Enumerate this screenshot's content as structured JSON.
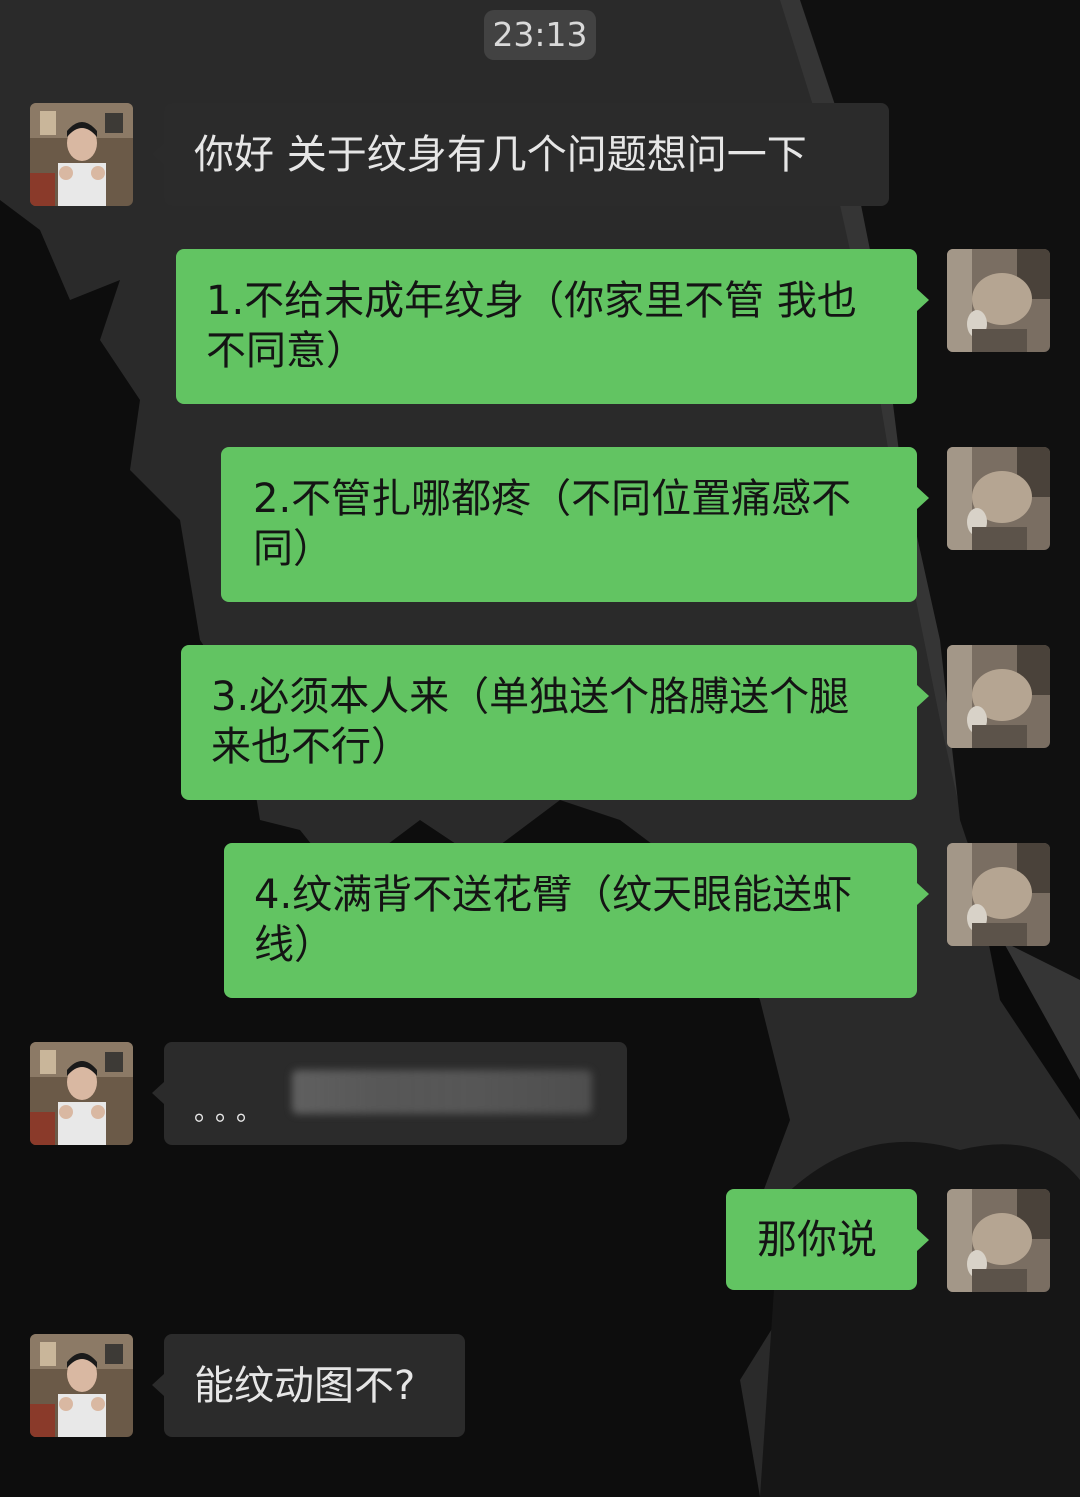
{
  "status": {
    "time": "23:13"
  },
  "contacts": {
    "other_avatar": "person-avatar",
    "self_avatar": "cat-photo-avatar"
  },
  "messages": [
    {
      "side": "in",
      "text": "你好 关于纹身有几个问题想问一下"
    },
    {
      "side": "out",
      "lines": [
        "1.不给未成年纹身（你家里不管 我也",
        "不同意）"
      ]
    },
    {
      "side": "out",
      "lines": [
        "2.不管扎哪都疼（不同位置痛感不",
        "同）"
      ]
    },
    {
      "side": "out",
      "lines": [
        "3.必须本人来（单独送个胳膊送个腿",
        "来也不行）"
      ]
    },
    {
      "side": "out",
      "lines": [
        "4.纹满背不送花臂（纹天眼能送虾",
        "线）"
      ]
    },
    {
      "side": "in",
      "text": "。。。",
      "note": "redacted"
    },
    {
      "side": "out",
      "text": "那你说"
    },
    {
      "side": "in",
      "text": "能纹动图不?"
    }
  ],
  "colors": {
    "incoming_bubble": "#2b2b2b",
    "outgoing_bubble": "#62c462",
    "background": "#0b0b0b"
  }
}
